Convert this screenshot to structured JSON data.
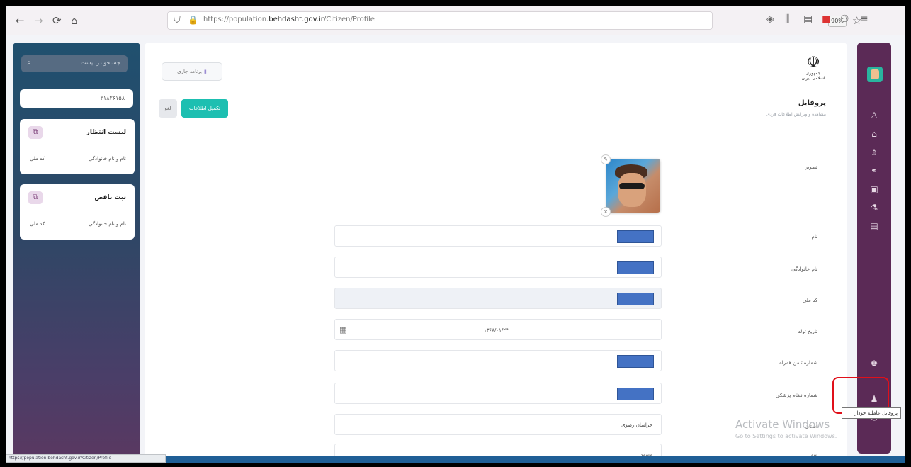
{
  "browser": {
    "url_prefix": "https://population.",
    "url_domain": "behdasht.gov.ir",
    "url_path": "/Citizen/Profile",
    "zoom": "90%",
    "status_url": "https://population.behdasht.gov.ir/Citizen/Profile"
  },
  "left_panel": {
    "search_placeholder": "جستجو در لیست",
    "code_value": "۳۱۸۲۶۱۵۸",
    "cards": [
      {
        "title": "لیست انتظار",
        "label_name": "نام و نام خانوادگی",
        "label_code": "کد ملی"
      },
      {
        "title": "ثبت ناقص",
        "label_name": "نام و نام خانوادگی",
        "label_code": "کد ملی"
      }
    ]
  },
  "main": {
    "top_button": "برنامه جاری",
    "green_button": "تکمیل اطلاعات",
    "gray_button": "لغو",
    "emblem_line1": "جمهوری",
    "emblem_line2": "اسلامی ایران",
    "page_title": "پروفایل",
    "page_subtitle": "مشاهده و ویرایش اطلاعات فردی",
    "labels": {
      "photo": "تصویر",
      "first_name": "نام",
      "last_name": "نام خانوادگی",
      "national_code": "کد ملی",
      "birth_date": "تاریخ تولد",
      "mobile": "شماره تلفن همراه",
      "insurance": "شماره نظام پزشکی",
      "province": "استان",
      "city": "شهر"
    },
    "birth_date_value": "۱۳۶۸/۰۱/۲۴",
    "province_value": "خراسان رضوی",
    "city_value": "مشهد"
  },
  "watermark": {
    "line1": "Activate Windows",
    "line2": "Go to Settings to activate Windows."
  },
  "tooltip": "پروفایل عاملیه خوداز",
  "colors": {
    "sidebar": "#5b2a56",
    "accent_green": "#1dbfb1",
    "highlight": "#e0101a"
  }
}
